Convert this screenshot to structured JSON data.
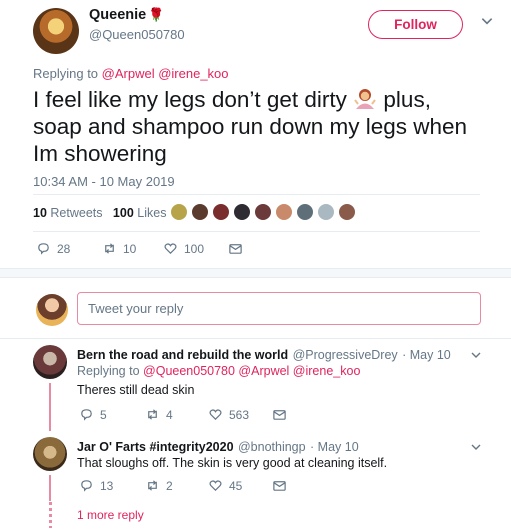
{
  "tweet": {
    "author_name": "Queenie",
    "author_handle": "@Queen050780",
    "follow_label": "Follow",
    "replying_prefix": "Replying to",
    "replying_to": "@Arpwel @irene_koo",
    "text_line1": "I feel like my legs don’t get dirty",
    "text_after_emoji": "plus,",
    "text_line2": "soap and shampoo run down my legs when",
    "text_line3": "Im showering",
    "timestamp": "10:34 AM - 10 May 2019",
    "retweets_count": "10",
    "retweets_label": "Retweets",
    "likes_count": "100",
    "likes_label": "Likes",
    "actions": {
      "replies": "28",
      "retweets": "10",
      "likes": "100"
    }
  },
  "compose": {
    "placeholder": "Tweet your reply"
  },
  "replies": [
    {
      "name": "Bern the road and rebuild the world",
      "handle": "@ProgressiveDrey",
      "date": "· May 10",
      "replying_prefix": "Replying to",
      "replying_to": "@Queen050780 @Arpwel @irene_koo",
      "text": "Theres still dead skin",
      "replies": "5",
      "retweets": "4",
      "likes": "563"
    },
    {
      "name": "Jar O' Farts #integrity2020",
      "handle": "@bnothingp",
      "date": "· May 10",
      "text": "That sloughs off. The skin is very good at cleaning itself.",
      "replies": "13",
      "retweets": "2",
      "likes": "45"
    }
  ],
  "more_replies_label": "1 more reply",
  "colors": {
    "accent": "#e0245e",
    "muted": "#657786",
    "thread": "#e88aa4"
  },
  "icons": [
    "reply-icon",
    "retweet-icon",
    "like-icon",
    "message-icon",
    "chevron-down-icon",
    "rose-icon",
    "woman-shrugging-icon"
  ]
}
